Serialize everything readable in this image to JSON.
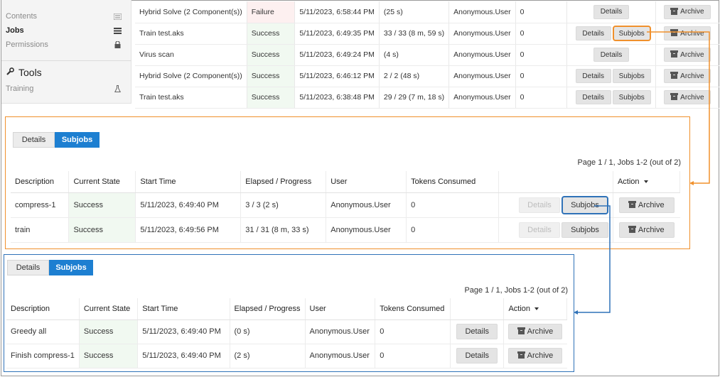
{
  "sidebar": {
    "items": [
      {
        "label": "Contents",
        "icon": "list-icon"
      },
      {
        "label": "Jobs",
        "icon": "list-icon"
      },
      {
        "label": "Permissions",
        "icon": "lock-icon"
      }
    ],
    "tools_heading": "Tools",
    "tools_items": [
      {
        "label": "Training",
        "icon": "flask-icon"
      }
    ]
  },
  "jobs": {
    "rows": [
      {
        "name": "Hybrid Solve (2 Component(s))",
        "state": "Failure",
        "start": "5/11/2023, 6:58:44 PM",
        "progress": "(25 s)",
        "user": "Anonymous.User",
        "tokens": "0",
        "subjobs": false
      },
      {
        "name": "Train test.aks",
        "state": "Success",
        "start": "5/11/2023, 6:49:35 PM",
        "progress": "33 / 33 (8 m, 59 s)",
        "user": "Anonymous.User",
        "tokens": "0",
        "subjobs": true
      },
      {
        "name": "Virus scan",
        "state": "Success",
        "start": "5/11/2023, 6:49:24 PM",
        "progress": "(4 s)",
        "user": "Anonymous.User",
        "tokens": "0",
        "subjobs": false
      },
      {
        "name": "Hybrid Solve (2 Component(s))",
        "state": "Success",
        "start": "5/11/2023, 6:46:12 PM",
        "progress": "2 / 2 (48 s)",
        "user": "Anonymous.User",
        "tokens": "0",
        "subjobs": true
      },
      {
        "name": "Train test.aks",
        "state": "Success",
        "start": "5/11/2023, 6:38:48 PM",
        "progress": "29 / 29 (7 m, 18 s)",
        "user": "Anonymous.User",
        "tokens": "0",
        "subjobs": true
      }
    ],
    "details_label": "Details",
    "subjobs_label": "Subjobs",
    "archive_label": "Archive"
  },
  "subpanel1": {
    "tabs": [
      "Details",
      "Subjobs"
    ],
    "page_info": "Page 1 / 1, Jobs 1-2 (out of 2)",
    "headers": [
      "Description",
      "Current State",
      "Start Time",
      "Elapsed / Progress",
      "User",
      "Tokens Consumed",
      "",
      "Action"
    ],
    "rows": [
      {
        "desc": "compress-1",
        "state": "Success",
        "start": "5/11/2023, 6:49:40 PM",
        "progress": "3 / 3 (2 s)",
        "user": "Anonymous.User",
        "tokens": "0"
      },
      {
        "desc": "train",
        "state": "Success",
        "start": "5/11/2023, 6:49:56 PM",
        "progress": "31 / 31 (8 m, 33 s)",
        "user": "Anonymous.User",
        "tokens": "0"
      }
    ],
    "details_label": "Details",
    "subjobs_label": "Subjobs",
    "archive_label": "Archive"
  },
  "subpanel2": {
    "tabs": [
      "Details",
      "Subjobs"
    ],
    "page_info": "Page 1 / 1, Jobs 1-2 (out of 2)",
    "headers": [
      "Description",
      "Current State",
      "Start Time",
      "Elapsed / Progress",
      "User",
      "Tokens Consumed",
      "",
      "Action"
    ],
    "rows": [
      {
        "desc": "Greedy all",
        "state": "Success",
        "start": "5/11/2023, 6:49:40 PM",
        "progress": "(0 s)",
        "user": "Anonymous.User",
        "tokens": "0"
      },
      {
        "desc": "Finish compress-1",
        "state": "Success",
        "start": "5/11/2023, 6:49:40 PM",
        "progress": "(2 s)",
        "user": "Anonymous.User",
        "tokens": "0"
      }
    ],
    "details_label": "Details",
    "archive_label": "Archive"
  },
  "colors": {
    "accent": "#1d7fd1",
    "orange_highlight": "#f0902c",
    "blue_highlight": "#2f72b8",
    "success": "#2e8b36",
    "failure": "#c43a3a"
  }
}
